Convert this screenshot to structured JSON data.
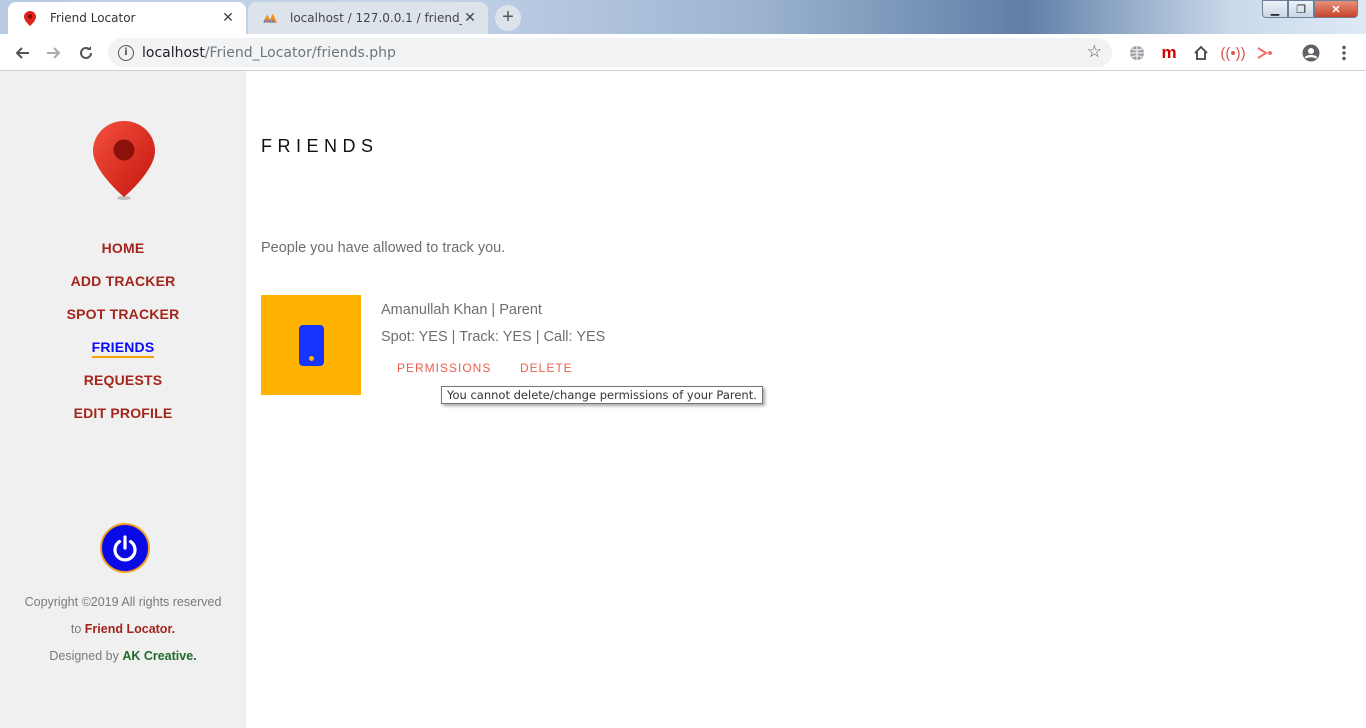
{
  "browser": {
    "tabs": [
      {
        "title": "Friend Locator",
        "favicon": "map-pin-icon"
      },
      {
        "title": "localhost / 127.0.0.1 / friend_loca",
        "favicon": "phpmyadmin-icon"
      }
    ],
    "close_glyph": "✕",
    "new_tab_glyph": "+",
    "window_controls": {
      "minimize": "▁",
      "maximize": "❐",
      "close": "✕"
    },
    "url": {
      "host": "localhost",
      "path": "/Friend_Locator/friends.php"
    }
  },
  "sidebar": {
    "nav": [
      {
        "label": "HOME"
      },
      {
        "label": "ADD TRACKER"
      },
      {
        "label": "SPOT TRACKER"
      },
      {
        "label": "FRIENDS",
        "active": true
      },
      {
        "label": "REQUESTS"
      },
      {
        "label": "EDIT PROFILE"
      }
    ],
    "footer": {
      "copyright": "Copyright ©2019 All rights reserved to ",
      "brand": "Friend Locator.",
      "designed_by": "Designed by ",
      "designer": "AK Creative."
    }
  },
  "main": {
    "title": "FRIENDS",
    "intro": "People you have allowed to track you.",
    "friend": {
      "name_line": "Amanullah Khan | Parent",
      "permissions_line": "Spot: YES | Track: YES | Call: YES",
      "permissions_button": "PERMISSIONS",
      "delete_button": "DELETE",
      "tooltip": "You cannot delete/change permissions of your Parent."
    }
  },
  "colors": {
    "nav_text": "#a3251c",
    "nav_active": "#0a0aff",
    "accent_orange": "#ffb300",
    "action_link": "#e8604c"
  }
}
